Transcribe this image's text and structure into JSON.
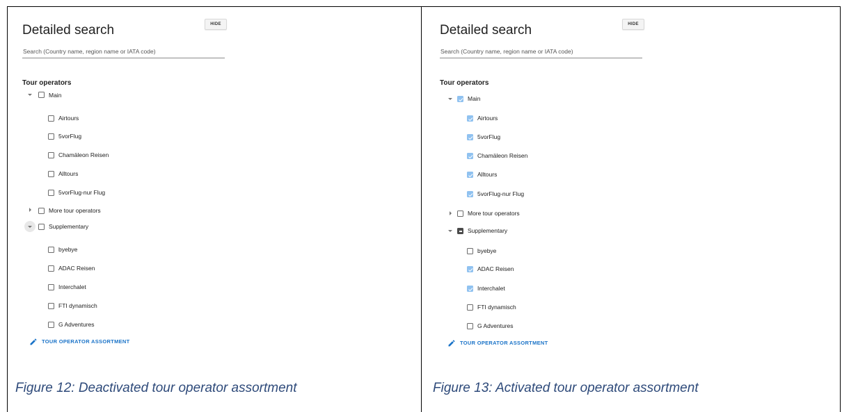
{
  "panels": [
    {
      "title": "Detailed search",
      "hide_label": "HIDE",
      "search_placeholder": "Search (Country name, region name or IATA code)",
      "section_title": "Tour operators",
      "groups": [
        {
          "label": "Main",
          "expanded": true,
          "state": "unchecked",
          "items": [
            {
              "label": "Airtours",
              "checked": false
            },
            {
              "label": "5vorFlug",
              "checked": false
            },
            {
              "label": "Chamäleon Reisen",
              "checked": false
            },
            {
              "label": "Alltours",
              "checked": false
            },
            {
              "label": "5vorFlug-nur Flug",
              "checked": false
            }
          ]
        },
        {
          "label": "More tour operators",
          "expanded": false,
          "state": "unchecked",
          "items": []
        },
        {
          "label": "Supplementary",
          "expanded": true,
          "state": "unchecked",
          "items": [
            {
              "label": "byebye",
              "checked": false
            },
            {
              "label": "ADAC Reisen",
              "checked": false
            },
            {
              "label": "Interchalet",
              "checked": false
            },
            {
              "label": "FTI dynamisch",
              "checked": false
            },
            {
              "label": "G Adventures",
              "checked": false
            }
          ]
        }
      ],
      "assortment_link": "TOUR OPERATOR ASSORTMENT",
      "caption": "Figure 12: Deactivated tour operator assortment"
    },
    {
      "title": "Detailed search",
      "hide_label": "HIDE",
      "search_placeholder": "Search (Country name, region name or IATA code)",
      "section_title": "Tour operators",
      "groups": [
        {
          "label": "Main",
          "expanded": true,
          "state": "checked",
          "items": [
            {
              "label": "Airtours",
              "checked": true
            },
            {
              "label": "5vorFlug",
              "checked": true
            },
            {
              "label": "Chamäleon Reisen",
              "checked": true
            },
            {
              "label": "Alltours",
              "checked": true
            },
            {
              "label": "5vorFlug-nur Flug",
              "checked": true
            }
          ]
        },
        {
          "label": "More tour operators",
          "expanded": false,
          "state": "unchecked",
          "items": []
        },
        {
          "label": "Supplementary",
          "expanded": true,
          "state": "indeterminate",
          "items": [
            {
              "label": "byebye",
              "checked": false
            },
            {
              "label": "ADAC Reisen",
              "checked": true
            },
            {
              "label": "Interchalet",
              "checked": true
            },
            {
              "label": "FTI dynamisch",
              "checked": false
            },
            {
              "label": "G Adventures",
              "checked": false
            }
          ]
        }
      ],
      "assortment_link": "TOUR OPERATOR ASSORTMENT",
      "caption": "Figure 13: Activated tour operator assortment"
    }
  ],
  "colors": {
    "checked": "#90c2f0",
    "indeterminate": "#4a4a4a",
    "link": "#1a73c8",
    "caption": "#2e4a7a"
  },
  "icons": {
    "expanded": "caret-down-icon",
    "collapsed": "caret-right-icon",
    "link": "pencil-icon"
  }
}
